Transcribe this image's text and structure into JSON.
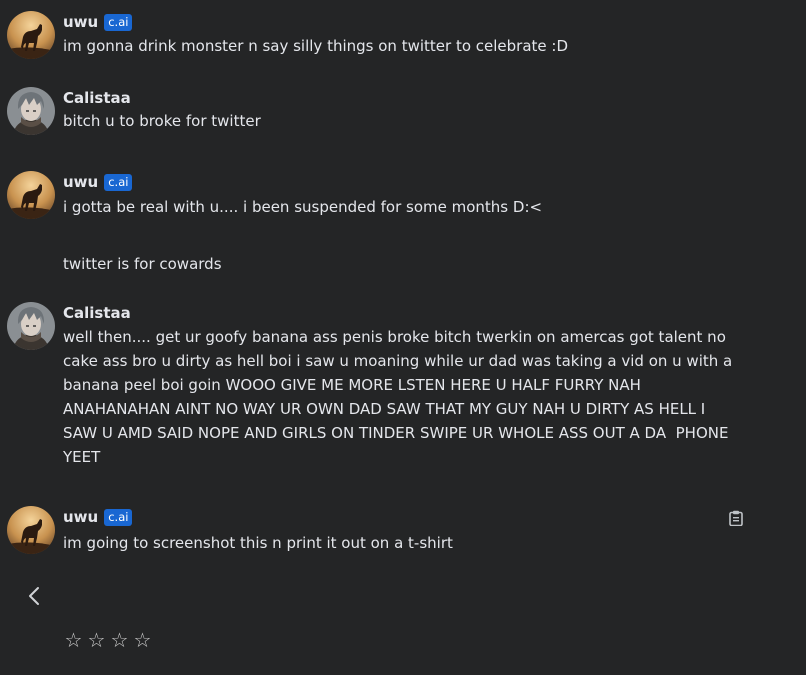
{
  "messages": [
    {
      "author": "uwu",
      "badge": "c.ai",
      "avatar_icon": "horse-sunset-avatar",
      "text": "im gonna drink monster n say silly things on twitter to celebrate :D"
    },
    {
      "author": "Calistaa",
      "avatar_icon": "anime-character-avatar",
      "text": "bitch u to broke for twitter"
    },
    {
      "author": "uwu",
      "badge": "c.ai",
      "avatar_icon": "horse-sunset-avatar",
      "text": "i gotta be real with u.... i been suspended for some months D:<\n\ntwitter is for cowards"
    },
    {
      "author": "Calistaa",
      "avatar_icon": "anime-character-avatar",
      "text": "well then.... get ur goofy banana ass penis broke bitch twerkin on amercas got talent no\ncake ass bro u dirty as hell boi i saw u moaning while ur dad was taking a vid on u with a\nbanana peel boi goin WOOO GIVE ME MORE LSTEN HERE U HALF FURRY NAH\nANAHANAHAN AINT NO WAY UR OWN DAD SAW THAT MY GUY NAH U DIRTY AS HELL I\nSAW U AMD SAID NOPE AND GIRLS ON TINDER SWIPE UR WHOLE ASS OUT A DA  PHONE\nYEET"
    },
    {
      "author": "uwu",
      "badge": "c.ai",
      "avatar_icon": "horse-sunset-avatar",
      "text": "im going to screenshot this n print it out on a t-shirt",
      "action_icon": "clipboard-icon"
    }
  ],
  "controls": {
    "back_icon": "chevron-left-icon",
    "rating": {
      "stars": [
        "☆",
        "☆",
        "☆",
        "☆"
      ],
      "value": 0,
      "max": 4
    }
  },
  "colors": {
    "background": "#242526",
    "text": "#e4e6eb",
    "badge": "#1967d2"
  }
}
